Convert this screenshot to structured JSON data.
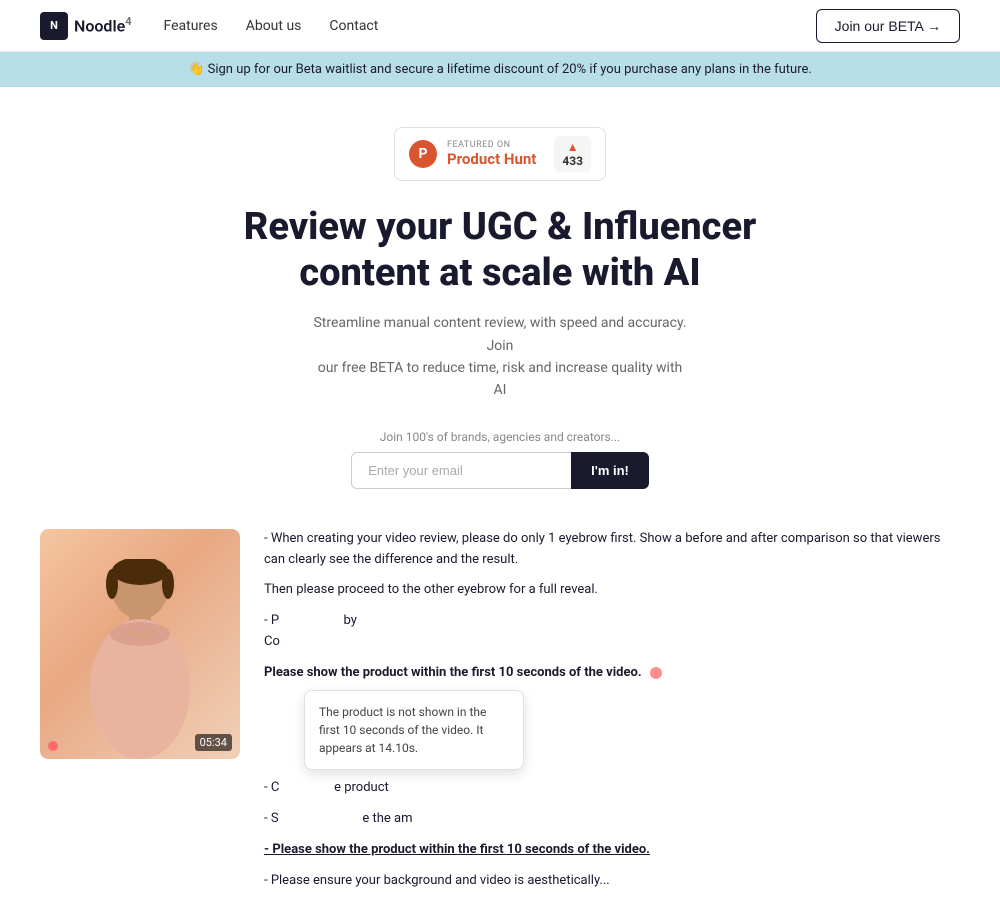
{
  "navbar": {
    "logo_icon_text": "N",
    "logo_name": "Noodle",
    "logo_sup": "4",
    "nav_links": [
      {
        "label": "Features"
      },
      {
        "label": "About us"
      },
      {
        "label": "Contact"
      }
    ],
    "beta_button": "Join our BETA →"
  },
  "banner": {
    "emoji": "👋",
    "text": "Sign up for our Beta waitlist and secure a lifetime discount of 20% if you purchase any plans in the future."
  },
  "hero": {
    "product_hunt": {
      "featured_text": "FEATURED ON",
      "name": "Product Hunt",
      "arrow": "▲",
      "count": "433"
    },
    "title_line1": "Review your UGC & Influencer",
    "title_line2": "content at scale with AI",
    "subtitle_line1": "Streamline manual content review, with speed and accuracy. Join",
    "subtitle_line2": "our free BETA to reduce time, risk and increase quality with AI",
    "email_label": "Join 100's of brands, agencies and creators...",
    "email_placeholder": "Enter your email",
    "submit_label": "I'm in!"
  },
  "content": {
    "video_timestamp": "05:34",
    "review_block1": "- When creating your video review, please do only 1 eyebrow first. Show a before and after comparison so that viewers can clearly see the difference and the result.",
    "review_block2": "Then please proceed to the other eyebrow for a full reveal.",
    "review_block3_prefix": "- P",
    "review_block3_middle": "Co",
    "review_block3_suffix": "by",
    "review_block3_bold": "Please show the product within the first 10 seconds of the video.",
    "tooltip_text": "The product is not shown in the first 10 seconds of the video. It appears at 14.10s.",
    "review_block4_prefix": "- C",
    "review_block4_suffix": "e product",
    "review_block5": "- S",
    "review_block5_suffix": "e the am",
    "review_block6": "- Please show the product within the first 10 seconds of the video.",
    "review_block7": "- Please ensure your background and video is aesthetically..."
  }
}
